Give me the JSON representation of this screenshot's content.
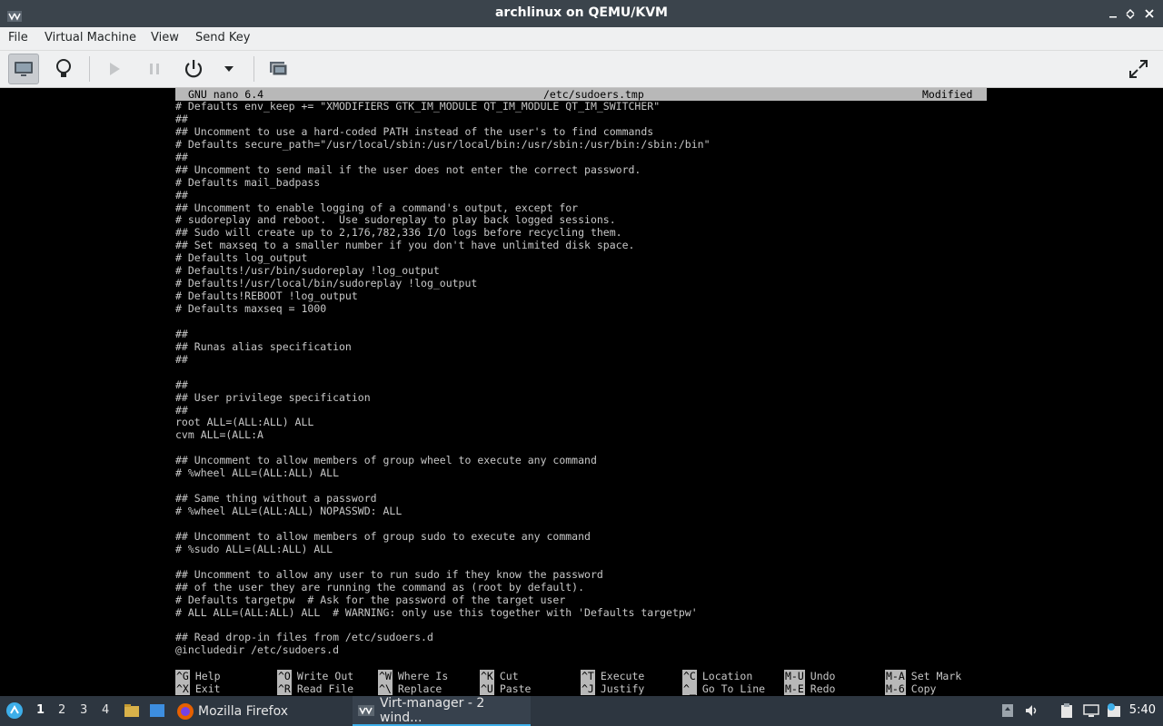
{
  "window": {
    "title": "archlinux on QEMU/KVM"
  },
  "menubar": {
    "items": [
      "File",
      "Virtual Machine",
      "View",
      "Send Key"
    ]
  },
  "toolbar": {
    "icons": [
      "console-icon",
      "details-bulb-icon",
      "run-icon",
      "pause-icon",
      "power-icon",
      "dropdown-icon",
      "snapshots-icon",
      "fullscreen-icon"
    ]
  },
  "nano": {
    "version": "GNU nano 6.4",
    "filename": "/etc/sudoers.tmp",
    "status": "Modified",
    "lines": [
      "# Defaults env_keep += \"XMODIFIERS GTK_IM_MODULE QT_IM_MODULE QT_IM_SWITCHER\"",
      "##",
      "## Uncomment to use a hard-coded PATH instead of the user's to find commands",
      "# Defaults secure_path=\"/usr/local/sbin:/usr/local/bin:/usr/sbin:/usr/bin:/sbin:/bin\"",
      "##",
      "## Uncomment to send mail if the user does not enter the correct password.",
      "# Defaults mail_badpass",
      "##",
      "## Uncomment to enable logging of a command's output, except for",
      "# sudoreplay and reboot.  Use sudoreplay to play back logged sessions.",
      "## Sudo will create up to 2,176,782,336 I/O logs before recycling them.",
      "## Set maxseq to a smaller number if you don't have unlimited disk space.",
      "# Defaults log_output",
      "# Defaults!/usr/bin/sudoreplay !log_output",
      "# Defaults!/usr/local/bin/sudoreplay !log_output",
      "# Defaults!REBOOT !log_output",
      "# Defaults maxseq = 1000",
      "",
      "##",
      "## Runas alias specification",
      "##",
      "",
      "##",
      "## User privilege specification",
      "##",
      "root ALL=(ALL:ALL) ALL",
      "cvm ALL=(ALL:A",
      "",
      "## Uncomment to allow members of group wheel to execute any command",
      "# %wheel ALL=(ALL:ALL) ALL",
      "",
      "## Same thing without a password",
      "# %wheel ALL=(ALL:ALL) NOPASSWD: ALL",
      "",
      "## Uncomment to allow members of group sudo to execute any command",
      "# %sudo ALL=(ALL:ALL) ALL",
      "",
      "## Uncomment to allow any user to run sudo if they know the password",
      "## of the user they are running the command as (root by default).",
      "# Defaults targetpw  # Ask for the password of the target user",
      "# ALL ALL=(ALL:ALL) ALL  # WARNING: only use this together with 'Defaults targetpw'",
      "",
      "## Read drop-in files from /etc/sudoers.d",
      "@includedir /etc/sudoers.d"
    ],
    "shortcuts_row1": [
      {
        "key": "^G",
        "label": "Help"
      },
      {
        "key": "^O",
        "label": "Write Out"
      },
      {
        "key": "^W",
        "label": "Where Is"
      },
      {
        "key": "^K",
        "label": "Cut"
      },
      {
        "key": "^T",
        "label": "Execute"
      },
      {
        "key": "^C",
        "label": "Location"
      },
      {
        "key": "M-U",
        "label": "Undo"
      },
      {
        "key": "M-A",
        "label": "Set Mark"
      }
    ],
    "shortcuts_row2": [
      {
        "key": "^X",
        "label": "Exit"
      },
      {
        "key": "^R",
        "label": "Read File"
      },
      {
        "key": "^\\",
        "label": "Replace"
      },
      {
        "key": "^U",
        "label": "Paste"
      },
      {
        "key": "^J",
        "label": "Justify"
      },
      {
        "key": "^_",
        "label": "Go To Line"
      },
      {
        "key": "M-E",
        "label": "Redo"
      },
      {
        "key": "M-6",
        "label": "Copy"
      }
    ]
  },
  "taskbar": {
    "workspaces": [
      "1",
      "2",
      "3",
      "4"
    ],
    "tasks": [
      {
        "label": "Mozilla Firefox"
      },
      {
        "label": "Virt-manager - 2 wind..."
      }
    ],
    "clock": "5:40"
  }
}
